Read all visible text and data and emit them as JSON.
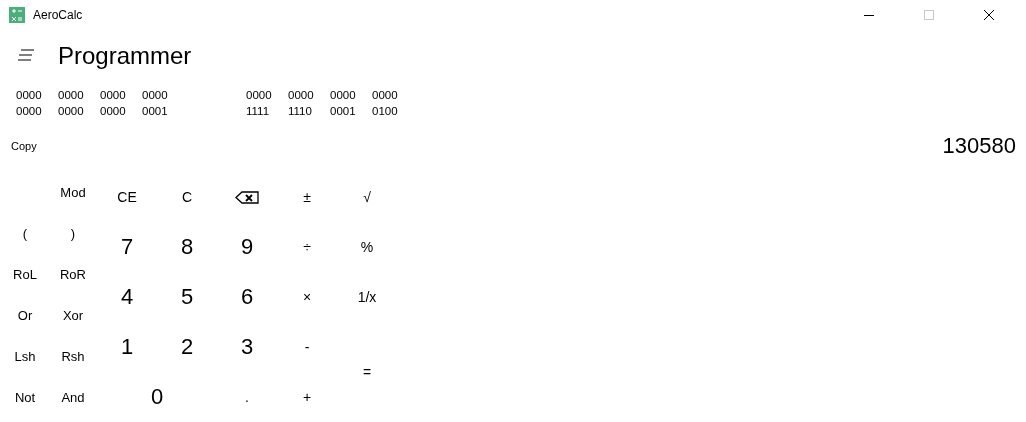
{
  "window": {
    "title": "AeroCalc",
    "controls": [
      {
        "kind": "minimize",
        "disabled": false
      },
      {
        "kind": "maximize",
        "disabled": true
      },
      {
        "kind": "close",
        "disabled": false
      }
    ]
  },
  "header": {
    "title": "Programmer"
  },
  "binary": [
    [
      "0000",
      "0000",
      "0000",
      "0000"
    ],
    [
      "0000",
      "0000",
      "0000",
      "0001"
    ],
    [
      "0000",
      "0000",
      "0000",
      "0000"
    ],
    [
      "1111",
      "1110",
      "0001",
      "0100"
    ]
  ],
  "copy": "Copy",
  "display": "130580",
  "side_keys": [
    {
      "label": "Mod"
    },
    {
      "label": "("
    },
    {
      "label": ")"
    },
    {
      "label": "RoL"
    },
    {
      "label": "RoR"
    },
    {
      "label": "Or"
    },
    {
      "label": "Xor"
    },
    {
      "label": "Lsh"
    },
    {
      "label": "Rsh"
    },
    {
      "label": "Not"
    },
    {
      "label": "And"
    }
  ],
  "keys": [
    {
      "kind": "op",
      "label": "CE"
    },
    {
      "kind": "op",
      "label": "C"
    },
    {
      "kind": "backspace"
    },
    {
      "kind": "op",
      "label": "±"
    },
    {
      "kind": "op",
      "label": "√"
    },
    {
      "kind": "digit",
      "label": "7"
    },
    {
      "kind": "digit",
      "label": "8"
    },
    {
      "kind": "digit",
      "label": "9"
    },
    {
      "kind": "op",
      "label": "÷"
    },
    {
      "kind": "op",
      "label": "%"
    },
    {
      "kind": "digit",
      "label": "4"
    },
    {
      "kind": "digit",
      "label": "5"
    },
    {
      "kind": "digit",
      "label": "6"
    },
    {
      "kind": "op",
      "label": "×"
    },
    {
      "kind": "op",
      "label": "1/x"
    },
    {
      "kind": "digit",
      "label": "1"
    },
    {
      "kind": "digit",
      "label": "2"
    },
    {
      "kind": "digit",
      "label": "3"
    },
    {
      "kind": "op",
      "label": "-"
    },
    {
      "kind": "equals",
      "label": "="
    },
    {
      "kind": "wide-digit",
      "label": "0"
    },
    {
      "kind": "op",
      "label": "."
    },
    {
      "kind": "op",
      "label": "+"
    }
  ]
}
